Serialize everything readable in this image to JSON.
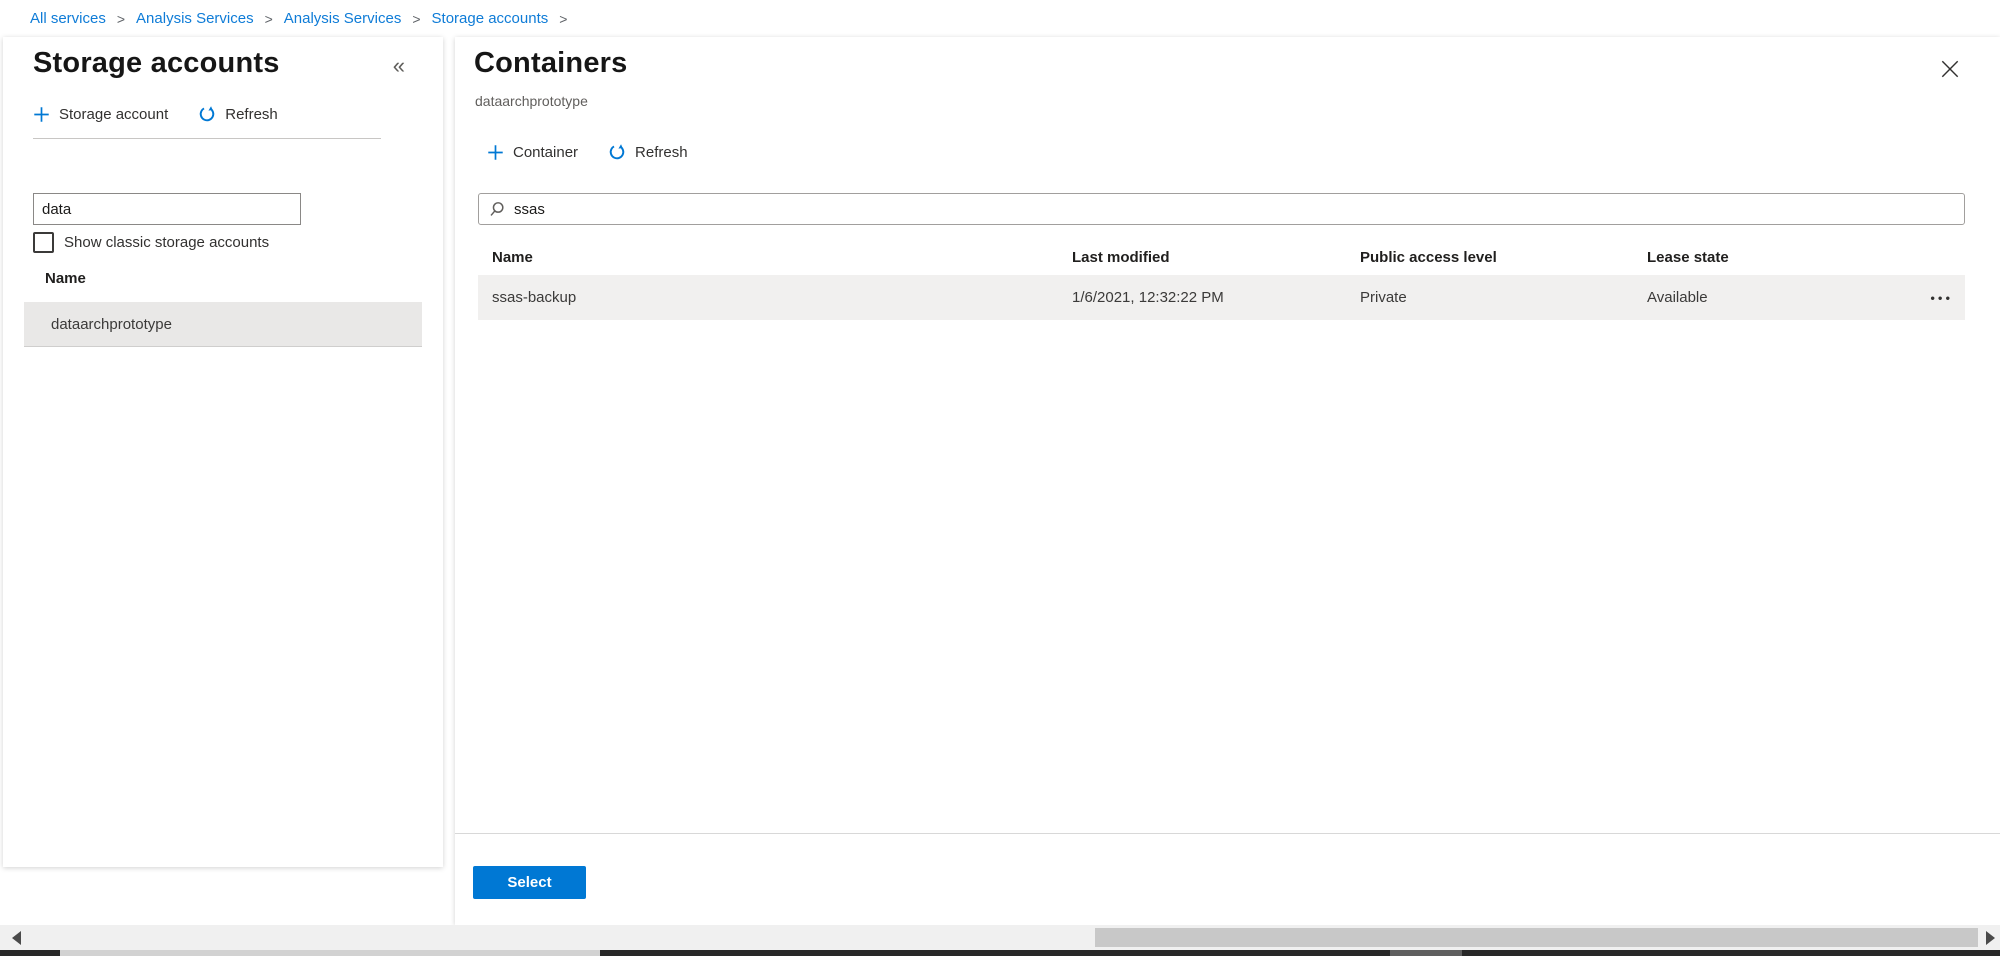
{
  "breadcrumb": {
    "separator": ">",
    "items": [
      {
        "label": "All services"
      },
      {
        "label": "Analysis Services"
      },
      {
        "label": "Analysis Services"
      },
      {
        "label": "Storage accounts"
      }
    ]
  },
  "icons": {
    "collapse": "«",
    "more": "•••"
  },
  "colors": {
    "accent": "#0078d4",
    "link": "#0f7cd7",
    "selected_row_bg": "#e9e8e7",
    "table_row_bg": "#f1f0ef"
  },
  "left_panel": {
    "title": "Storage accounts",
    "toolbar": {
      "add_label": "Storage account",
      "refresh_label": "Refresh"
    },
    "filter_value": "data",
    "checkbox_label": "Show classic storage accounts",
    "checkbox_checked": false,
    "column_header": "Name",
    "rows": [
      {
        "name": "dataarchprototype",
        "selected": true
      }
    ]
  },
  "right_panel": {
    "title": "Containers",
    "subtitle": "dataarchprototype",
    "toolbar": {
      "add_label": "Container",
      "refresh_label": "Refresh"
    },
    "search_value": "ssas",
    "table": {
      "columns": [
        "Name",
        "Last modified",
        "Public access level",
        "Lease state"
      ],
      "rows": [
        {
          "name": "ssas-backup",
          "last_modified": "1/6/2021, 12:32:22 PM",
          "public_access_level": "Private",
          "lease_state": "Available"
        }
      ]
    },
    "select_button_label": "Select"
  }
}
